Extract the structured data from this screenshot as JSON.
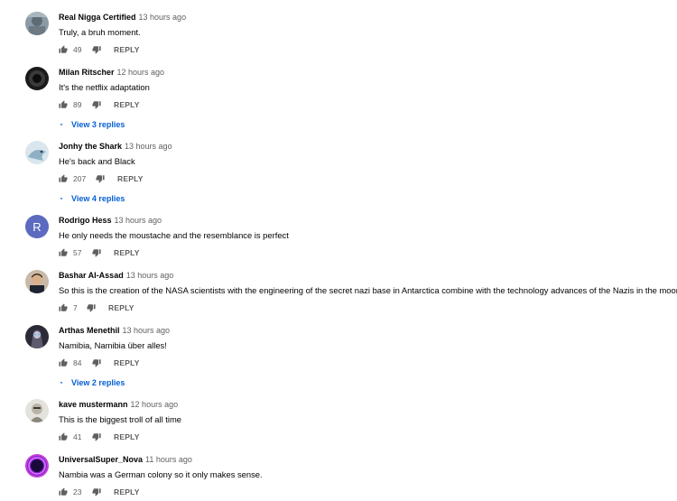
{
  "reply_label": "REPLY",
  "comments": [
    {
      "author": "Real Nigga Certified",
      "time": "13 hours ago",
      "text": "Truly, a bruh moment.",
      "likes": "49",
      "replies": null
    },
    {
      "author": "Milan Ritscher",
      "time": "12 hours ago",
      "text": "It's the netflix adaptation",
      "likes": "89",
      "replies": "View 3 replies"
    },
    {
      "author": "Jonhy the Shark",
      "time": "13 hours ago",
      "text": "He's back and Black",
      "likes": "207",
      "replies": "View 4 replies"
    },
    {
      "author": "Rodrigo Hess",
      "time": "13 hours ago",
      "text": "He only needs the moustache and the resemblance is perfect",
      "likes": "57",
      "replies": null,
      "avatar_letter": "R"
    },
    {
      "author": "Bashar Al-Assad",
      "time": "13 hours ago",
      "text": "So this is the creation of the NASA scientists with the engineering of the secret nazi base in Antarctica combine with the technology advances of the Nazis in the moon?",
      "likes": "7",
      "replies": null
    },
    {
      "author": "Arthas Menethil",
      "time": "13 hours ago",
      "text": "Namibia, Namibia über alles!",
      "likes": "84",
      "replies": "View 2 replies"
    },
    {
      "author": "kave mustermann",
      "time": "12 hours ago",
      "text": "This is the biggest troll of all time",
      "likes": "41",
      "replies": null
    },
    {
      "author": "UniversalSuper_Nova",
      "time": "11 hours ago",
      "text": "Nambia was a German colony so it only makes sense.",
      "likes": "23",
      "replies": null
    }
  ],
  "colors": {
    "link_blue": "#065fd4",
    "secondary_text": "#606060",
    "avatar_letter_bg": "#5c6bc0"
  }
}
